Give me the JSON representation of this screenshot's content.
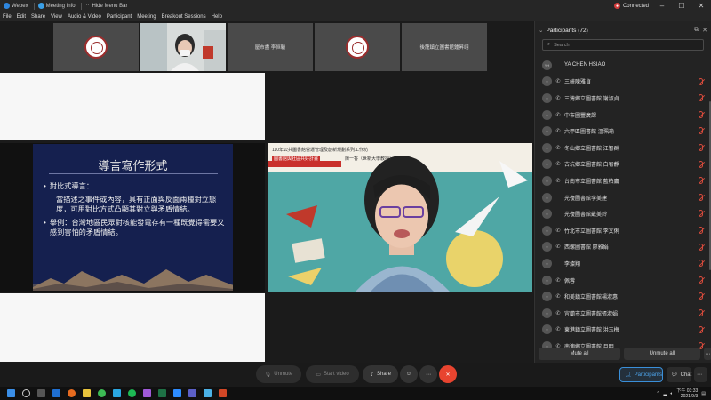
{
  "titlebar": {
    "app": "Webex",
    "meeting_info": "Meeting Info",
    "hide_menu": "Hide Menu Bar",
    "status": "Connected",
    "window_controls": [
      "–",
      "☐",
      "✕"
    ]
  },
  "menubar": [
    "File",
    "Edit",
    "Share",
    "View",
    "Audio & Video",
    "Participant",
    "Meeting",
    "Breakout Sessions",
    "Help"
  ],
  "thumbnails": [
    {
      "type": "seal",
      "name": ""
    },
    {
      "type": "camera",
      "name": ""
    },
    {
      "type": "name",
      "name": "屋市盡 李恒驪"
    },
    {
      "type": "seal",
      "name": ""
    },
    {
      "type": "name",
      "name": "後龍鎮立圖書館鍾昇翊"
    }
  ],
  "slide": {
    "title": "導言寫作形式",
    "bullet1": "對比式導言：",
    "para1": "當描述之事件或內容，具有正面與反面兩種對立態度，可用對比方式凸顯其對立與矛盾情結。",
    "bullet2": "舉例：台灣地區民眾對核能發電存有一種既覺得需要又感到害怕的矛盾情結。"
  },
  "video_banner": {
    "line1": "110年公共圖書館營運管理及創新規劃系列工作坊",
    "line2": "圖書館與社區共好計畫",
    "line3": "陳一香（世新大學教授）"
  },
  "participants": {
    "header": "Participants (72)",
    "search_placeholder": "Search",
    "list": [
      {
        "avatar": "YH",
        "phone": false,
        "name": "YA CHEN HSIAO"
      },
      {
        "avatar": "",
        "phone": true,
        "name": "三峽陳雅貞"
      },
      {
        "avatar": "",
        "phone": true,
        "name": "三灣鄉立圖書館 謝淑貞"
      },
      {
        "avatar": "",
        "phone": true,
        "name": "中市圖豐廣課"
      },
      {
        "avatar": "",
        "phone": true,
        "name": "六甲區圖書館-溫珮瑜"
      },
      {
        "avatar": "",
        "phone": true,
        "name": "冬山鄉立圖書館 江智群"
      },
      {
        "avatar": "",
        "phone": true,
        "name": "古坑鄉立圖書館 白宥靜"
      },
      {
        "avatar": "",
        "phone": true,
        "name": "台南市立圖書館 藍柏鷹"
      },
      {
        "avatar": "",
        "phone": false,
        "name": "光復圖書館李美建"
      },
      {
        "avatar": "",
        "phone": false,
        "name": "光復圖書館戴美鈴"
      },
      {
        "avatar": "",
        "phone": true,
        "name": "竹北市立圖書館 李文俐"
      },
      {
        "avatar": "",
        "phone": true,
        "name": "西螺圖書館 廖雅娟"
      },
      {
        "avatar": "",
        "phone": false,
        "name": "李燦翔"
      },
      {
        "avatar": "",
        "phone": true,
        "name": "佩蓉"
      },
      {
        "avatar": "",
        "phone": true,
        "name": "和美鎮立圖書館楊淑惠"
      },
      {
        "avatar": "",
        "phone": true,
        "name": "宜蘭市立圖書館張淑娟"
      },
      {
        "avatar": "",
        "phone": true,
        "name": "東港鎮立圖書館 洪玉梅"
      },
      {
        "avatar": "",
        "phone": true,
        "name": "南澳鄉立圖書館 月明"
      }
    ],
    "mute_all": "Mute all",
    "unmute_all": "Unmute all"
  },
  "controls": {
    "unmute": "Unmute",
    "start_video": "Start video",
    "share": "Share",
    "participants": "Participants",
    "chat": "Chat"
  },
  "taskbar": {
    "time": "下午 03:33",
    "date": "2021/9/3"
  }
}
